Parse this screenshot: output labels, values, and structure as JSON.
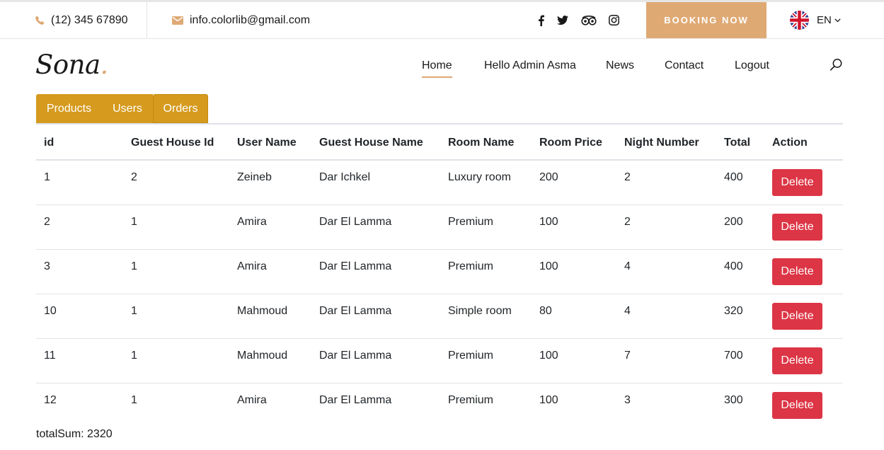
{
  "topbar": {
    "phone": "(12) 345 67890",
    "email": "info.colorlib@gmail.com",
    "social_icons": [
      "facebook-icon",
      "twitter-icon",
      "tripadvisor-icon",
      "instagram-icon"
    ],
    "booking_label": "BOOKING NOW",
    "language": "EN"
  },
  "brand": {
    "logo": "Sona",
    "logo_dot": "."
  },
  "nav": {
    "items": [
      "Home",
      "Hello Admin Asma",
      "News",
      "Contact",
      "Logout"
    ],
    "active": "Home"
  },
  "tabs": [
    "Products",
    "Users",
    "Orders"
  ],
  "table": {
    "columns": [
      "id",
      "Guest House Id",
      "User Name",
      "Guest House Name",
      "Room Name",
      "Room Price",
      "Night Number",
      "Total",
      "Action"
    ],
    "rows": [
      [
        "1",
        "2",
        "Zeineb",
        "Dar Ichkel",
        "Luxury room",
        "200",
        "2",
        "400",
        "Delete"
      ],
      [
        "2",
        "1",
        "Amira",
        "Dar El Lamma",
        "Premium",
        "100",
        "2",
        "200",
        "Delete"
      ],
      [
        "3",
        "1",
        "Amira",
        "Dar El Lamma",
        "Premium",
        "100",
        "4",
        "400",
        "Delete"
      ],
      [
        "10",
        "1",
        "Mahmoud",
        "Dar El Lamma",
        "Simple room",
        "80",
        "4",
        "320",
        "Delete"
      ],
      [
        "11",
        "1",
        "Mahmoud",
        "Dar El Lamma",
        "Premium",
        "100",
        "7",
        "700",
        "Delete"
      ],
      [
        "12",
        "1",
        "Amira",
        "Dar El Lamma",
        "Premium",
        "100",
        "3",
        "300",
        "Delete"
      ]
    ]
  },
  "summary": {
    "total_label": "totalSum: 2320"
  },
  "colors": {
    "accent": "#dfa974",
    "tab": "#d59a1e",
    "delete": "#dc3545"
  }
}
